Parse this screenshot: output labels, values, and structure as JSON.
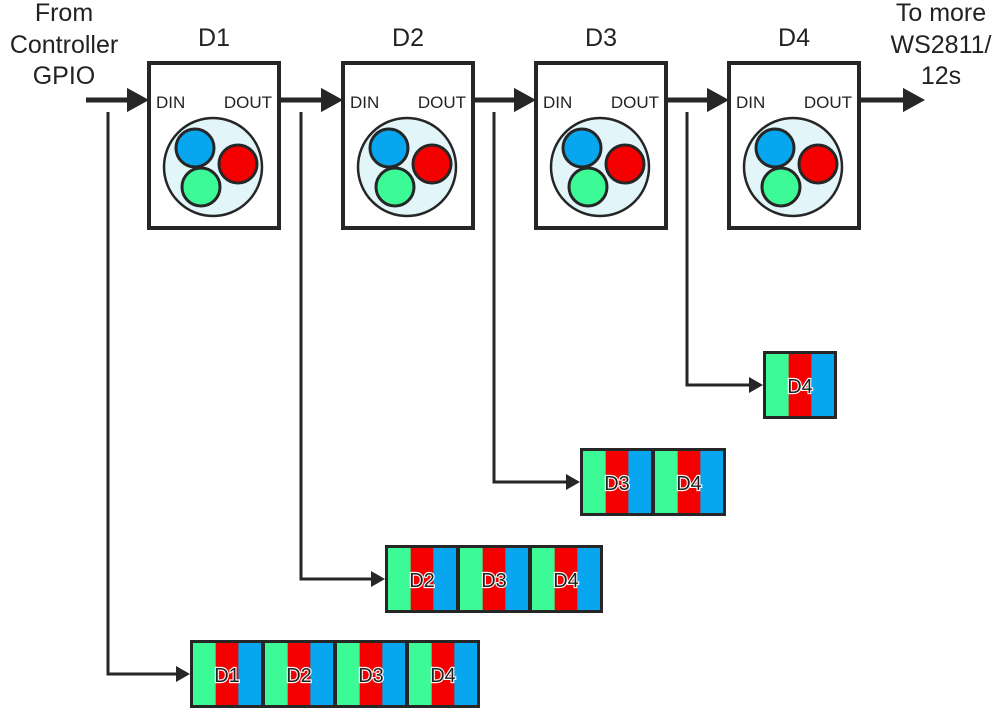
{
  "labels": {
    "source": [
      "From",
      "Controller",
      "GPIO"
    ],
    "destination": [
      "To more",
      "WS2811/",
      "12s"
    ]
  },
  "pins": {
    "input": "DIN",
    "output": "DOUT"
  },
  "colors": {
    "line": "#262626",
    "led_body": "#e2f6fa",
    "blue": "#08a6ee",
    "red": "#f50000",
    "green": "#3cfa96"
  },
  "devices": [
    {
      "name": "D1"
    },
    {
      "name": "D2"
    },
    {
      "name": "D3"
    },
    {
      "name": "D4"
    }
  ],
  "data_streams": [
    {
      "tap": "D1 DIN",
      "packets": [
        "D1",
        "D2",
        "D3",
        "D4"
      ]
    },
    {
      "tap": "D2 DIN",
      "packets": [
        "D2",
        "D3",
        "D4"
      ]
    },
    {
      "tap": "D3 DIN",
      "packets": [
        "D3",
        "D4"
      ]
    },
    {
      "tap": "D4 DIN",
      "packets": [
        "D4"
      ]
    }
  ]
}
